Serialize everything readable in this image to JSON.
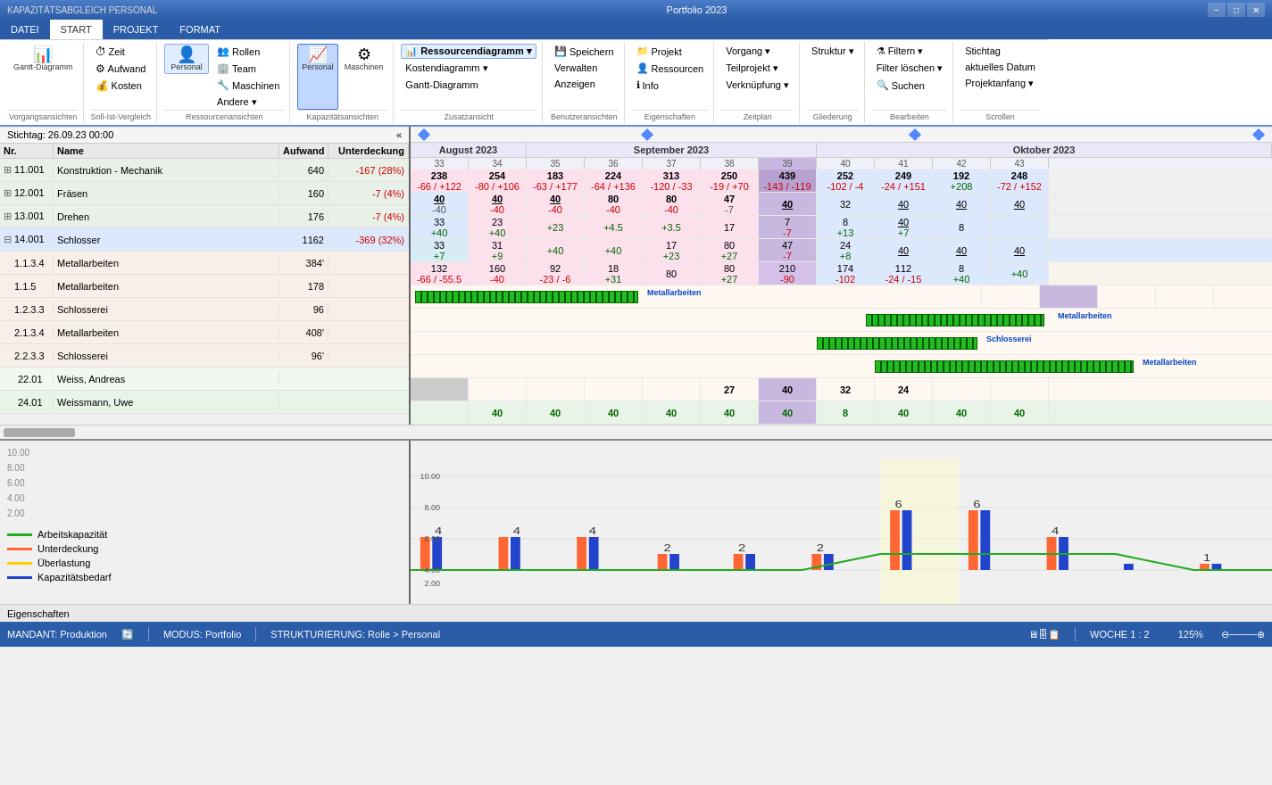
{
  "titlebar": {
    "doc_title": "KAPAZITÄTSABGLEICH PERSONAL",
    "app_title": "Portfolio 2023",
    "minimize": "−",
    "maximize": "□",
    "close": "✕"
  },
  "tabs": [
    {
      "label": "DATEI",
      "active": true
    },
    {
      "label": "START",
      "active": false
    },
    {
      "label": "PROJEKT",
      "active": false
    },
    {
      "label": "FORMAT",
      "active": false
    }
  ],
  "ribbon": {
    "groups": [
      {
        "label": "Vorgangsansichten",
        "buttons": [
          {
            "icon": "📊",
            "label": "Gantt-Diagramm"
          }
        ]
      },
      {
        "label": "Soll-Ist-Vergleich",
        "buttons": [
          {
            "icon": "⏱",
            "label": "Zeit"
          },
          {
            "icon": "⚙",
            "label": "Aufwand"
          },
          {
            "icon": "💰",
            "label": "Kosten"
          }
        ]
      },
      {
        "label": "Ressourcenansichten",
        "buttons": [
          {
            "icon": "👤",
            "label": "Personal"
          },
          {
            "label": "Rollen"
          },
          {
            "label": "Team"
          },
          {
            "label": "Maschinen"
          },
          {
            "label": "Andere ▾"
          }
        ]
      },
      {
        "label": "Kapazitätsansichten",
        "buttons": [
          {
            "icon": "📈",
            "label": "Personal",
            "active": true
          },
          {
            "icon": "🔧",
            "label": "Maschinen"
          }
        ]
      },
      {
        "label": "Zusatzansicht",
        "buttons": [
          {
            "label": "Ressourcendiagramm ▾"
          },
          {
            "label": "Kostendiagramm ▾"
          },
          {
            "label": "Gantt-Diagramm"
          }
        ]
      },
      {
        "label": "Benutzeransichten",
        "buttons": [
          {
            "label": "Speichern"
          },
          {
            "label": "Verwalten"
          },
          {
            "label": "Anzeigen"
          }
        ]
      },
      {
        "label": "Eigenschaften",
        "buttons": [
          {
            "label": "Projekt"
          },
          {
            "label": "Ressourcen"
          },
          {
            "label": "Info"
          }
        ]
      },
      {
        "label": "Zeitplan",
        "buttons": [
          {
            "label": "Vorgang ▾"
          },
          {
            "label": "Teilprojekt ▾"
          },
          {
            "label": "Verknüpfung ▾"
          }
        ]
      },
      {
        "label": "Gliederung",
        "buttons": [
          {
            "label": "Struktur ▾"
          }
        ]
      },
      {
        "label": "Bearbeiten",
        "buttons": [
          {
            "label": "Filtern ▾"
          },
          {
            "label": "Filter löschen ▾"
          },
          {
            "label": "Suchen"
          }
        ]
      },
      {
        "label": "Scrollen",
        "buttons": [
          {
            "label": "Stichtag"
          },
          {
            "label": "aktuelles Datum"
          },
          {
            "label": "Projektanfang ▾"
          }
        ]
      }
    ]
  },
  "stichtag": "Stichtag: 26.09.23 00:00",
  "columns": {
    "nr": "Nr.",
    "name": "Name",
    "aufwand": "Aufwand",
    "unterdeckung": "Unterdeckung"
  },
  "rows": [
    {
      "nr": "11.001",
      "name": "Konstruktion - Mechanik",
      "aufwand": "640",
      "unterdeckung": "-167 (28%)",
      "type": "group",
      "highlight": false
    },
    {
      "nr": "12.001",
      "name": "Fräsen",
      "aufwand": "160",
      "unterdeckung": "-7 (4%)",
      "type": "group",
      "highlight": false
    },
    {
      "nr": "13.001",
      "name": "Drehen",
      "aufwand": "176",
      "unterdeckung": "-7 (4%)",
      "type": "group",
      "highlight": false
    },
    {
      "nr": "14.001",
      "name": "Schlosser",
      "aufwand": "1162",
      "unterdeckung": "-369 (32%)",
      "type": "group",
      "highlight": true
    },
    {
      "nr": "1.1.3.4",
      "name": "Metallarbeiten",
      "aufwand": "384'",
      "unterdeckung": "",
      "type": "sub",
      "highlight": false
    },
    {
      "nr": "1.1.5",
      "name": "Metallarbeiten",
      "aufwand": "178",
      "unterdeckung": "",
      "type": "sub",
      "highlight": false
    },
    {
      "nr": "1.2.3.3",
      "name": "Schlosserei",
      "aufwand": "96",
      "unterdeckung": "",
      "type": "sub",
      "highlight": false
    },
    {
      "nr": "2.1.3.4",
      "name": "Metallarbeiten",
      "aufwand": "408'",
      "unterdeckung": "",
      "type": "sub",
      "highlight": false
    },
    {
      "nr": "2.2.3.3",
      "name": "Schlosserei",
      "aufwand": "96'",
      "unterdeckung": "",
      "type": "sub",
      "highlight": false
    },
    {
      "nr": "22.01",
      "name": "Weiss, Andreas",
      "aufwand": "",
      "unterdeckung": "",
      "type": "person",
      "highlight": false
    },
    {
      "nr": "24.01",
      "name": "Weissmann, Uwe",
      "aufwand": "",
      "unterdeckung": "",
      "type": "person",
      "highlight": false
    }
  ],
  "timeline": {
    "months": [
      {
        "label": "August 2023",
        "weeks": 2
      },
      {
        "label": "September 2023",
        "weeks": 5
      },
      {
        "label": "Oktober 2023",
        "weeks": 5
      }
    ],
    "weeks": [
      "33",
      "34",
      "35",
      "36",
      "37",
      "38",
      "39",
      "40",
      "41",
      "42",
      "43"
    ]
  },
  "chart_data": {
    "row0": [
      {
        "top": "238",
        "bot": "-66 / +122",
        "bg": "pink"
      },
      {
        "top": "254",
        "bot": "-80 / +106",
        "bg": "pink"
      },
      {
        "top": "183",
        "bot": "-63 / +177",
        "bg": "pink"
      },
      {
        "top": "224",
        "bot": "-64 / +136",
        "bg": "pink"
      },
      {
        "top": "313",
        "bot": "-120 / -33",
        "bg": "pink"
      },
      {
        "top": "250",
        "bot": "-19 / +70",
        "bg": "pink"
      },
      {
        "top": "439",
        "bot": "-143 / -119",
        "bg": "purple"
      },
      {
        "top": "252",
        "bot": "-102 / -4",
        "bg": "blue"
      },
      {
        "top": "249",
        "bot": "-24 / +151",
        "bg": "blue"
      },
      {
        "top": "192",
        "bot": "+208",
        "bg": "blue"
      },
      {
        "top": "248",
        "bot": "-72 / +152",
        "bg": "blue"
      }
    ]
  },
  "bottom_chart": {
    "legend": [
      {
        "color": "#22aa22",
        "label": "Arbeitskapazität"
      },
      {
        "color": "#ff6633",
        "label": "Unterdeckung"
      },
      {
        "color": "#ffcc00",
        "label": "Überlastung"
      },
      {
        "color": "#2244cc",
        "label": "Kapazitätsbedarf"
      }
    ],
    "y_labels": [
      "2.00",
      "4.00",
      "6.00",
      "8.00",
      "10.00"
    ],
    "bar_values": [
      {
        "week": "33",
        "bars": [
          4
        ]
      },
      {
        "week": "34",
        "bars": [
          4
        ]
      },
      {
        "week": "35",
        "bars": [
          4
        ]
      },
      {
        "week": "36",
        "bars": [
          2
        ]
      },
      {
        "week": "37",
        "bars": [
          2
        ]
      },
      {
        "week": "38",
        "bars": [
          2
        ]
      },
      {
        "week": "39",
        "bars": [
          6
        ]
      },
      {
        "week": "40",
        "bars": [
          6
        ]
      },
      {
        "week": "41",
        "bars": [
          4
        ]
      },
      {
        "week": "42",
        "bars": []
      },
      {
        "week": "43",
        "bars": [
          1
        ]
      }
    ]
  },
  "statusbar": {
    "mandant": "MANDANT: Produktion",
    "modus": "MODUS: Portfolio",
    "strukturierung": "STRUKTURIERUNG: Rolle > Personal",
    "woche": "WOCHE 1 : 2",
    "zoom": "125%"
  },
  "properties_label": "Eigenschaften"
}
